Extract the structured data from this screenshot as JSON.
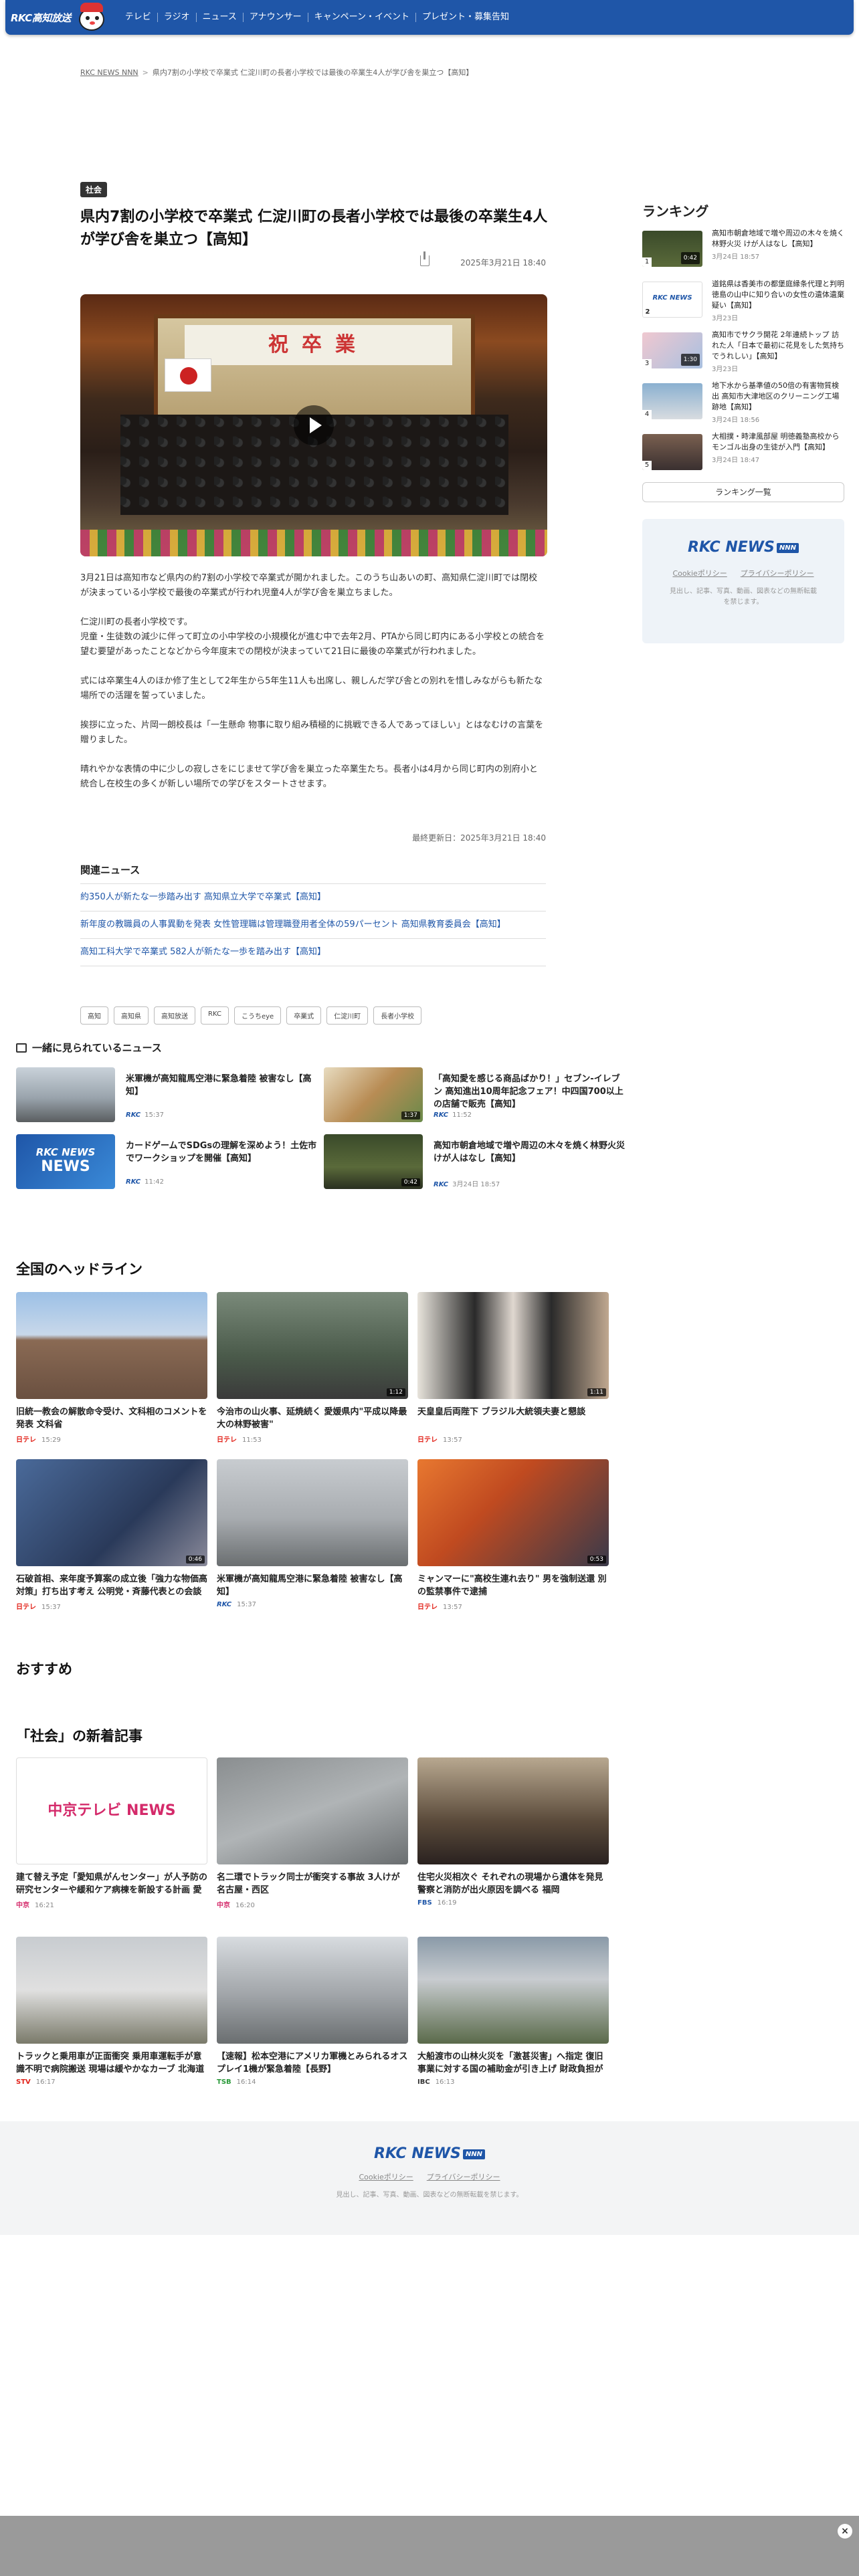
{
  "header": {
    "logo": "RKC高知放送",
    "nav": [
      "テレビ",
      "ラジオ",
      "ニュース",
      "アナウンサー",
      "キャンペーン・イベント",
      "プレゼント・募集告知"
    ]
  },
  "breadcrumb": [
    "RKC NEWS NNN",
    "県内7割の小学校で卒業式 仁淀川町の長者小学校では最後の卒業生4人が学び舎を巣立つ【高知】"
  ],
  "article": {
    "tag": "社会",
    "title": "県内7割の小学校で卒業式 仁淀川町の長者小学校では最後の卒業生4人が学び舎を巣立つ【高知】",
    "date": "2025年3月21日 18:40",
    "banner_text": "祝卒業",
    "p1": "3月21日は高知市など県内の約7割の小学校で卒業式が開かれました。このうち山あいの町、高知県仁淀川町では閉校が決まっている小学校で最後の卒業式が行われ児童4人が学び舎を巣立ちました。",
    "p2": "仁淀川町の長者小学校です。\n児童・生徒数の減少に伴って町立の小中学校の小規模化が進む中で去年2月、PTAから同じ町内にある小学校との統合を望む要望があったことなどから今年度末での閉校が決まっていて21日に最後の卒業式が行われました。",
    "p3": "式には卒業生4人のほか修了生として2年生から5年生11人も出席し、親しんだ学び舎との別れを惜しみながらも新たな場所での活躍を誓っていました。",
    "p4": "挨拶に立った、片岡一朗校長は「一生懸命 物事に取り組み積極的に挑戦できる人であってほしい」とはなむけの言葉を贈りました。",
    "p5": "晴れやかな表情の中に少しの寂しさをにじませて学び舎を巣立った卒業生たち。長者小は4月から同じ町内の別府小と統合し在校生の多くが新しい場所での学びをスタートさせます。",
    "updated": "最終更新日：2025年3月21日 18:40"
  },
  "related": {
    "heading": "関連ニュース",
    "items": [
      "約350人が新たな一歩踏み出す 高知県立大学で卒業式【高知】",
      "新年度の教職員の人事異動を発表 女性管理職は管理職登用者全体の59パーセント 高知県教育委員会【高知】",
      "高知工科大学で卒業式 582人が新たな一歩を踏み出す【高知】"
    ]
  },
  "tags": [
    "高知",
    "高知県",
    "高知放送",
    "RKC",
    "こうちeye",
    "卒業式",
    "仁淀川町",
    "長者小学校"
  ],
  "also_seen": {
    "heading": "一緒に見られているニュース",
    "items": [
      {
        "title": "米軍機が高知龍馬空港に緊急着陸 被害なし【高知】",
        "src": "RKC",
        "time": "15:37",
        "dur": ""
      },
      {
        "title": "「高知愛を感じる商品ばかり！」セブン‐イレブン 高知進出10周年記念フェア！中四国700以上の店舗で販売【高知】",
        "src": "RKC",
        "time": "11:52",
        "dur": "1:37"
      },
      {
        "title": "カードゲームでSDGsの理解を深めよう！土佐市でワークショップを開催【高知】",
        "src": "RKC",
        "time": "11:42",
        "dur": ""
      },
      {
        "title": "高知市朝倉地域で増や周辺の木々を焼く林野火災 けが人はなし【高知】",
        "src": "RKC",
        "time": "3月24日 18:57",
        "dur": "0:42"
      }
    ]
  },
  "ranking": {
    "heading": "ランキング",
    "items": [
      {
        "title": "高知市朝倉地域で増や周辺の木々を焼く林野火災 けが人はなし【高知】",
        "date": "3月24日 18:57",
        "dur": "0:42"
      },
      {
        "title": "道銘県は香美市の都堡庭縁条代理と判明 徳島の山中に知り合いの女性の遺体遺棄疑い【高知】",
        "date": "3月23日",
        "dur": ""
      },
      {
        "title": "高知市でサクラ開花 2年連続トップ 訪れた人「日本で最初に花見をした気持ちでうれしい」【高知】",
        "date": "3月23日",
        "dur": "1:30"
      },
      {
        "title": "地下水から基準値の50倍の有害物質検出 高知市大津地区のクリーニング工場跡地【高知】",
        "date": "3月24日 18:56",
        "dur": ""
      },
      {
        "title": "大相撲・時津風部屋 明徳義塾高校からモンゴル出身の生徒が入門【高知】",
        "date": "3月24日 18:47",
        "dur": ""
      }
    ],
    "more": "ランキング一覧"
  },
  "sidebar_box": {
    "logo": "RKC NEWS",
    "logo_badge": "NNN",
    "cookie": "Cookieポリシー",
    "privacy": "プライバシーポリシー",
    "note": "見出し、記事、写真、動画、図表などの無断転載を禁じます。"
  },
  "national": {
    "heading": "全国のヘッドライン",
    "items": [
      {
        "title": "旧統一教会の解散命令受け、文科相のコメントを発表 文科省",
        "src": "日テレ",
        "time": "15:29",
        "dur": ""
      },
      {
        "title": "今治市の山火事、延焼続く 愛媛県内\"平成以降最大の林野被害\"",
        "src": "日テレ",
        "time": "11:53",
        "dur": "1:12"
      },
      {
        "title": "天皇皇后両陛下 ブラジル大統領夫妻と懇談",
        "src": "日テレ",
        "time": "13:57",
        "dur": "1:11"
      },
      {
        "title": "石破首相、来年度予算案の成立後「強力な物価高対策」打ち出す考え 公明党・斉藤代表との会談で伝える",
        "src": "日テレ",
        "time": "15:37",
        "dur": "0:46"
      },
      {
        "title": "米軍機が高知龍馬空港に緊急着陸 被害なし【高知】",
        "src": "RKC",
        "time": "15:37",
        "dur": ""
      },
      {
        "title": "ミャンマーに\"高校生連れ去り\" 男を強制送還 別の監禁事件で逮捕",
        "src": "日テレ",
        "time": "13:57",
        "dur": "0:53"
      }
    ]
  },
  "recommend_heading": "おすすめ",
  "social": {
    "heading": "「社会」の新着記事",
    "items": [
      {
        "title": "建て替え予定「愛知県がんセンター」が人予防の研究センターや緩和ケア病棟を新設する計画 愛知県",
        "src": "中京",
        "time": "16:21"
      },
      {
        "title": "名二環でトラック同士が衝突する事故 3人けが 名古屋・西区",
        "src": "中京",
        "time": "16:20"
      },
      {
        "title": "住宅火災相次ぐ それぞれの現場から遺体を発見 警察と消防が出火原因を調べる 福岡",
        "src": "FBS",
        "time": "16:19"
      },
      {
        "title": "トラックと乗用車が正面衝突 乗用車運転手が意識不明で病院搬送 現場は緩やかなカーブ 北海道",
        "src": "STV",
        "time": "16:17"
      },
      {
        "title": "【速報】松本空港にアメリカ軍機とみられるオスプレイ1機が緊急着陸【長野】",
        "src": "TSB",
        "time": "16:14"
      },
      {
        "title": "大船渡市の山林火災を「激甚災害」へ指定 復旧事業に対する国の補助金が引き上げ 財政負担が軽減",
        "src": "IBC",
        "time": "16:13"
      }
    ]
  },
  "footer": {
    "logo": "RKC NEWS",
    "logo_badge": "NNN",
    "cookie": "Cookieポリシー",
    "privacy": "プライバシーポリシー",
    "note": "見出し、記事、写真、動画、図表などの無断転載を禁じます。"
  },
  "close_label": "×",
  "colors": {
    "brand": "#1f56a8",
    "link": "#1f56a8",
    "ntv_red": "#e2231a"
  }
}
